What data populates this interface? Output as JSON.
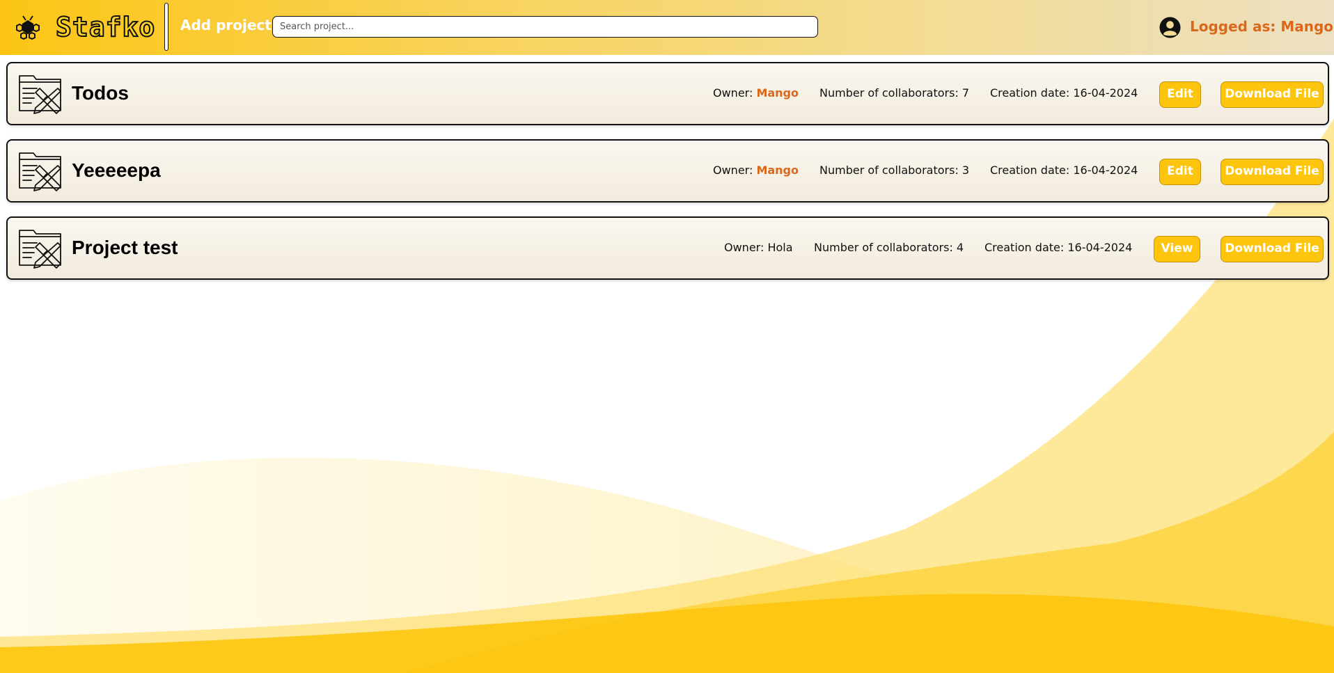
{
  "header": {
    "brand": "Stafko",
    "add_project_label": "Add project",
    "search_placeholder": "Search project...",
    "logged_in_label": "Logged as: Mango"
  },
  "projects": [
    {
      "name": "Todos",
      "owner_prefix": "Owner: ",
      "owner": "Mango",
      "collaborators": "Number of collaborators: 7",
      "creation_date": "Creation date: 16-04-2024",
      "action_label": "Edit",
      "download_label": "Download File"
    },
    {
      "name": "Yeeeeepa",
      "owner_prefix": "Owner: ",
      "owner": "Mango",
      "collaborators": "Number of collaborators: 3",
      "creation_date": "Creation date: 16-04-2024",
      "action_label": "Edit",
      "download_label": "Download File"
    },
    {
      "name": "Project test",
      "owner_text": "Owner: Hola",
      "collaborators": "Number of collaborators: 4",
      "creation_date": "Creation date: 16-04-2024",
      "action_label": "View",
      "download_label": "Download File"
    }
  ],
  "colors": {
    "accent_yellow": "#fdc50d",
    "accent_orange": "#d9681b"
  }
}
